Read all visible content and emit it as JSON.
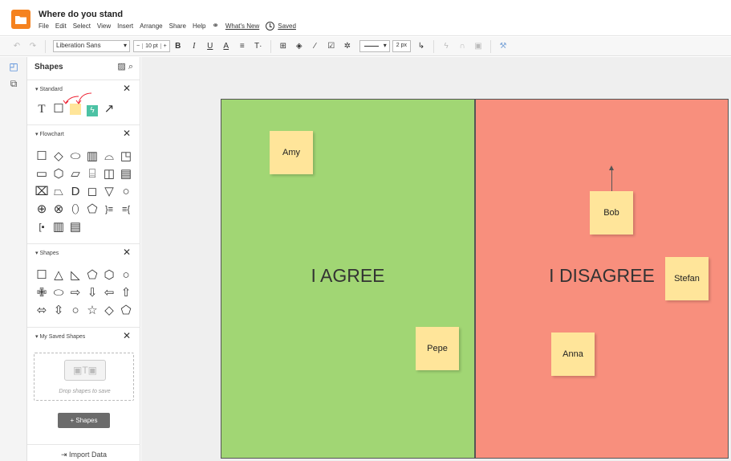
{
  "app": {
    "title": "Where do you stand",
    "menu": [
      "File",
      "Edit",
      "Select",
      "View",
      "Insert",
      "Arrange",
      "Share",
      "Help"
    ],
    "whats_new": "What's New",
    "saved": "Saved"
  },
  "toolbar": {
    "font": "Liberation Sans",
    "font_size": "10 pt",
    "minus": "−",
    "plus": "+",
    "line_width": "2 px"
  },
  "sidebar": {
    "title": "Shapes",
    "sections": {
      "standard": "Standard",
      "flowchart": "Flowchart",
      "shapes": "Shapes",
      "my_saved": "My Saved Shapes"
    },
    "drop_hint": "Drop shapes to save",
    "add_button": "Shapes",
    "import": "Import Data"
  },
  "canvas": {
    "agree_label": "I AGREE",
    "disagree_label": "I DISAGREE",
    "stickies": {
      "amy": "Amy",
      "pepe": "Pepe",
      "bob": "Bob",
      "stefan": "Stefan",
      "anna": "Anna"
    }
  },
  "colors": {
    "agree": "#a1d674",
    "disagree": "#f88f7d",
    "sticky": "#ffe59a",
    "logo": "#f5821f"
  }
}
